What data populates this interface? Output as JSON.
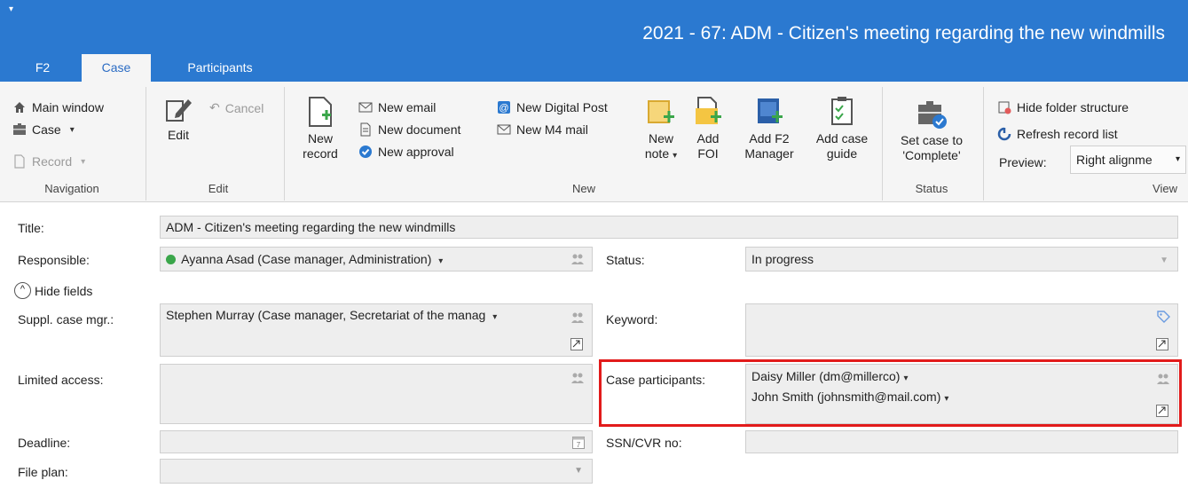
{
  "window": {
    "title": "2021 - 67: ADM - Citizen's meeting regarding the new windmills",
    "quick_access": "▾"
  },
  "tabs": [
    {
      "label": "F2"
    },
    {
      "label": "Case",
      "active": true
    },
    {
      "label": "Participants"
    }
  ],
  "ribbon": {
    "navigation": {
      "group_label": "Navigation",
      "main_window": "Main window",
      "case": "Case",
      "record": "Record"
    },
    "edit": {
      "group_label": "Edit",
      "edit": "Edit",
      "cancel": "Cancel"
    },
    "new": {
      "group_label": "New",
      "new_record_line1": "New",
      "new_record_line2": "record",
      "new_email": "New email",
      "new_document": "New document",
      "new_approval": "New approval",
      "new_digital_post": "New Digital Post",
      "new_m4_mail": "New M4 mail",
      "new_note_line1": "New",
      "new_note_line2": "note",
      "add_foi_line1": "Add",
      "add_foi_line2": "FOI",
      "add_f2_manager_line1": "Add F2",
      "add_f2_manager_line2": "Manager",
      "add_case_guide_line1": "Add case",
      "add_case_guide_line2": "guide"
    },
    "status": {
      "group_label": "Status",
      "set_complete_line1": "Set case to",
      "set_complete_line2": "'Complete'"
    },
    "view": {
      "group_label": "View",
      "hide_folder_structure": "Hide folder structure",
      "refresh_record_list": "Refresh record list",
      "preview_label": "Preview:",
      "preview_value": "Right alignme"
    }
  },
  "form": {
    "title_label": "Title:",
    "title_value": "ADM - Citizen's meeting regarding the new windmills",
    "responsible_label": "Responsible:",
    "responsible_value": "Ayanna Asad (Case manager, Administration)",
    "status_label": "Status:",
    "status_value": "In progress",
    "hide_fields": "Hide fields",
    "suppl_label": "Suppl. case mgr.:",
    "suppl_value": "Stephen Murray (Case manager, Secretariat of the manag",
    "keyword_label": "Keyword:",
    "keyword_value": "",
    "limited_label": "Limited access:",
    "limited_value": "",
    "participants_label": "Case participants:",
    "participants": [
      "Daisy Miller (dm@millerco)",
      "John Smith (johnsmith@mail.com)"
    ],
    "deadline_label": "Deadline:",
    "deadline_value": "",
    "ssn_label": "SSN/CVR no:",
    "ssn_value": "",
    "fileplan_label": "File plan:",
    "fileplan_value": ""
  },
  "colors": {
    "titlebar": "#2b79d0",
    "highlight": "#e21b1b",
    "status_dot": "#3aa64a"
  }
}
